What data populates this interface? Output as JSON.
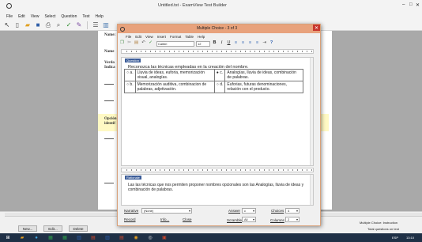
{
  "main_window": {
    "title": "Untitled.tst - ExamView Test Builder",
    "controls": {
      "minimize": "–",
      "maximize": "□",
      "close": "✕"
    },
    "menu": [
      "File",
      "Edit",
      "View",
      "Select",
      "Question",
      "Test",
      "Help"
    ]
  },
  "document": {
    "labels": [
      "Name:",
      "Name",
      "Verda",
      "Indica",
      "Opción",
      "identif"
    ]
  },
  "bottom": {
    "buttons": [
      "New...",
      "Edit...",
      "Delete"
    ],
    "status_1": "Multiple Choice: Instruction",
    "status_2": "Total questions on test"
  },
  "taskbar": {
    "lang": "ESP",
    "time": "13:10"
  },
  "dialog": {
    "title": "Multiple Choice - 3 of 3",
    "close": "✕",
    "menu": [
      "File",
      "Edit",
      "View",
      "Insert",
      "Format",
      "Table",
      "Help"
    ],
    "font": "Calibri",
    "font_size": "12",
    "fmt": {
      "bold": "B",
      "italic": "I",
      "underline": "U"
    },
    "question_tag": "Question",
    "question_text": "Reconozca las técnicas empleadas en la creación del nombre.",
    "answers": [
      {
        "letter": "a.",
        "text": "Lluvia de ideas, euforia, memorización visual, analogías.",
        "checked": false
      },
      {
        "letter": "c.",
        "text": "Analogías, lluvia de ideas, combinación de palabras.",
        "checked": true
      },
      {
        "letter": "b.",
        "text": "Memorización auditiva, combinacion de palabras, adjetivación.",
        "checked": false
      },
      {
        "letter": "d.",
        "text": "Euforias, futuras denominaciones, relación con el producto.",
        "checked": false
      }
    ],
    "feedback_tag": "Rationale",
    "feedback_text": "Las las técnicas que nos permiten proponer nombres opcionales son las Analogías, lluvia de ideas y combinación de palabras.",
    "bottom": {
      "narrative_label": "Narrative",
      "narrative_value": "(None)",
      "answer_label": "Answer",
      "answer_value": "c",
      "choices_label": "Choices",
      "choices_value": "4",
      "record_label": "Record",
      "info_label": "Info...",
      "close_label": "Close",
      "scramble_label": "Scramble",
      "scramble_value": "All",
      "columns_label": "Columns",
      "columns_value": "2"
    }
  }
}
